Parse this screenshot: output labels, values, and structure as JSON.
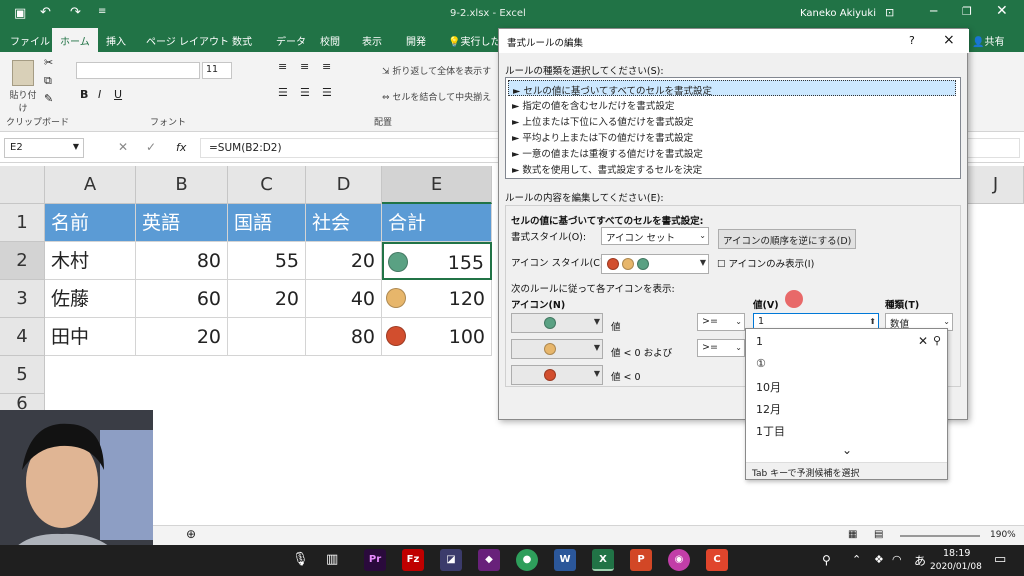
{
  "window": {
    "filename": "9-2.xlsx",
    "app": "Excel",
    "user": "Kaneko Akiyuki"
  },
  "tabs": [
    "ファイル",
    "ホーム",
    "挿入",
    "ページ レイアウト",
    "数式",
    "データ",
    "校閲",
    "表示",
    "開発",
    "実行した"
  ],
  "share_label": "共有",
  "ribbon": {
    "paste": "貼り付け",
    "clipboard": "クリップボード",
    "font": "フォント",
    "font_size": "11",
    "wrap": "折り返して全体を表示す",
    "merge": "セルを結合して中央揃え",
    "alignment": "配置",
    "bold": "B",
    "italic": "I",
    "underline": "U"
  },
  "formula_bar": {
    "name_box": "E2",
    "fx": "fx",
    "formula": "=SUM(B2:D2)"
  },
  "columns": [
    "A",
    "B",
    "C",
    "D",
    "E",
    "J"
  ],
  "rows": [
    "1",
    "2",
    "3",
    "4",
    "5",
    "6"
  ],
  "table": {
    "header": [
      "名前",
      "英語",
      "国語",
      "社会",
      "合計"
    ],
    "rows": [
      {
        "name": "木村",
        "eng": "80",
        "jpn": "55",
        "soc": "20",
        "total": "155",
        "icon": "green"
      },
      {
        "name": "佐藤",
        "eng": "60",
        "jpn": "20",
        "soc": "40",
        "total": "120",
        "icon": "yellow"
      },
      {
        "name": "田中",
        "eng": "20",
        "jpn": "",
        "soc": "80",
        "total": "100",
        "icon": "red"
      }
    ]
  },
  "colors": {
    "excel_green": "#217346",
    "header_blue": "#5b9bd5",
    "icon_green": "#5aa183",
    "icon_yellow": "#e7b66b",
    "icon_red": "#d24e2e"
  },
  "dialog": {
    "title": "書式ルールの編集",
    "help": "?",
    "close": "×",
    "select_type_label": "ルールの種類を選択してください(S):",
    "rule_types": [
      "► セルの値に基づいてすべてのセルを書式設定",
      "► 指定の値を含むセルだけを書式設定",
      "► 上位または下位に入る値だけを書式設定",
      "► 平均より上または下の値だけを書式設定",
      "► 一意の値または重複する値だけを書式設定",
      "► 数式を使用して、書式設定するセルを決定"
    ],
    "edit_label": "ルールの内容を編集してください(E):",
    "format_all_label": "セルの値に基づいてすべてのセルを書式設定:",
    "format_style_label": "書式スタイル(O):",
    "format_style_value": "アイコン セット",
    "reverse_button": "アイコンの順序を逆にする(D)",
    "icon_style_label": "アイコン スタイル(C):",
    "icon_only_label": "アイコンのみ表示(I)",
    "show_each_label": "次のルールに従って各アイコンを表示:",
    "icon_col": "アイコン(N)",
    "value_col": "値(V)",
    "type_col": "種類(T)",
    "row1_cond": "値",
    "row2_cond": "値 < 0 および",
    "row3_cond": "値 < 0",
    "op1": ">=",
    "op2": ">=",
    "value_input": "1",
    "type_value": "数値"
  },
  "autocomplete": {
    "items": [
      "1",
      "①",
      "10月",
      "12月",
      "1丁目"
    ],
    "hint": "Tab キーで予測候補を選択"
  },
  "status": {
    "zoom": "190%"
  },
  "taskbar": {
    "time": "18:19",
    "date": "2020/01/08",
    "ime": "あ"
  }
}
